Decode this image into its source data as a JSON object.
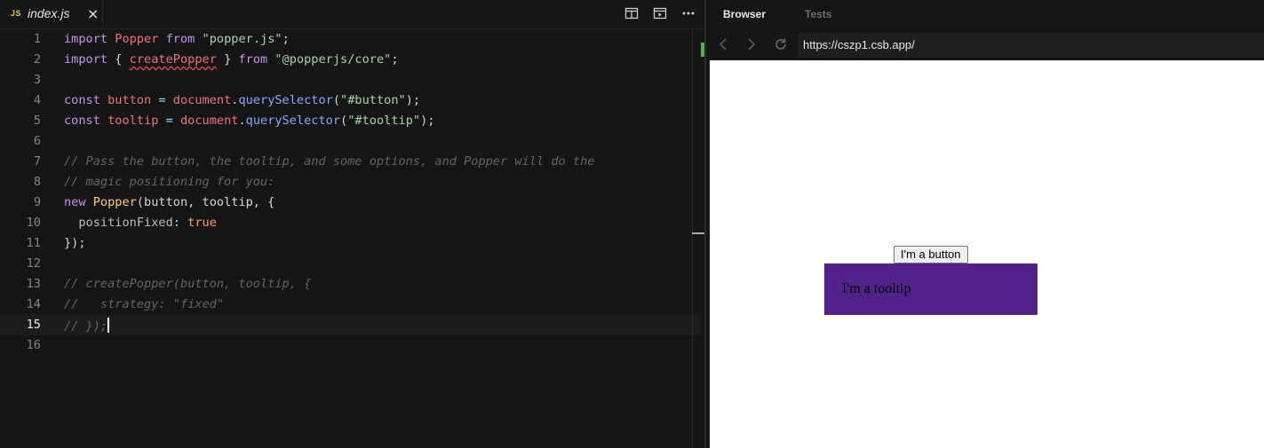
{
  "editor": {
    "tab": {
      "lang_badge": "JS",
      "filename": "index.js",
      "close_glyph": "×"
    },
    "toolbar": {
      "split_icon": "split-editor-icon",
      "preview_icon": "open-preview-icon",
      "more_icon": "more-actions-icon"
    },
    "active_line": 15,
    "lines": [
      {
        "num": "1"
      },
      {
        "num": "2"
      },
      {
        "num": "3"
      },
      {
        "num": "4"
      },
      {
        "num": "5"
      },
      {
        "num": "6"
      },
      {
        "num": "7"
      },
      {
        "num": "8"
      },
      {
        "num": "9"
      },
      {
        "num": "10"
      },
      {
        "num": "11"
      },
      {
        "num": "12"
      },
      {
        "num": "13"
      },
      {
        "num": "14"
      },
      {
        "num": "15"
      },
      {
        "num": "16"
      }
    ],
    "code": {
      "l1": {
        "import": "import",
        "name": "Popper",
        "from": "from",
        "src": "\"popper.js\"",
        "semi": ";"
      },
      "l2": {
        "import": "import",
        "open": " { ",
        "name": "createPopper",
        "close": " } ",
        "from": "from",
        "src": "\"@popperjs/core\"",
        "semi": ";"
      },
      "l4": {
        "const": "const",
        "name": "button",
        "eq": " = ",
        "obj": "document",
        "dot": ".",
        "fn": "querySelector",
        "arg": "\"#button\"",
        "end": ");"
      },
      "l5": {
        "const": "const",
        "name": "tooltip",
        "eq": " = ",
        "obj": "document",
        "dot": ".",
        "fn": "querySelector",
        "arg": "\"#tooltip\"",
        "end": ");"
      },
      "l7": "// Pass the button, the tooltip, and some options, and Popper will do the",
      "l8": "// magic positioning for you:",
      "l9": {
        "new": "new",
        "cls": "Popper",
        "args": "(button, tooltip, {"
      },
      "l10": {
        "prop": "positionFixed",
        "colon": ":",
        "val": "true"
      },
      "l11": "});",
      "l13": "// createPopper(button, tooltip, {",
      "l14": "//   strategy: \"fixed\"",
      "l15": "// });"
    }
  },
  "browser": {
    "tabs": [
      {
        "label": "Browser",
        "active": true
      },
      {
        "label": "Tests",
        "active": false
      }
    ],
    "url": "https://cszp1.csb.app/",
    "nav_icons": [
      "back-arrow-icon",
      "forward-arrow-icon",
      "refresh-icon"
    ],
    "preview": {
      "button_label": "I'm a button",
      "tooltip_text": "I'm a tooltip",
      "tooltip_color": "#512289"
    }
  }
}
